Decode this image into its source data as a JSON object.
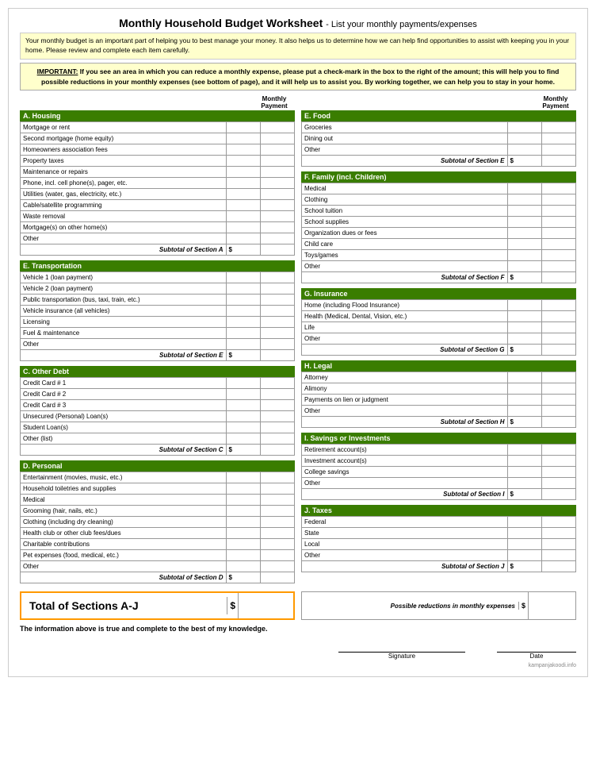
{
  "title": {
    "main": "Monthly Household Budget Worksheet",
    "subtitle": " - List your monthly payments/expenses"
  },
  "intro": "Your monthly budget is an important part of helping you to best manage your money. It also helps us to determine how we can help find opportunities to assist with keeping you in your home. Please review and complete each item carefully.",
  "important": {
    "prefix": "IMPORTANT:",
    "text": " If you see an area in which you can reduce a monthly expense, please put a check-mark in the box to the right of the amount; this will help you to find possible reductions in your monthly expenses (see bottom of page), and it will help us to assist you. By working together, we can help you to stay in your home."
  },
  "monthly_payment": "Monthly\nPayment",
  "left_column": {
    "sections": [
      {
        "id": "a",
        "header": "A. Housing",
        "items": [
          "Mortgage or rent",
          "Second mortgage (home equity)",
          "Homeowners association fees",
          "Property taxes",
          "Maintenance or repairs",
          "Phone, incl. cell phone(s), pager, etc.",
          "Utilities (water, gas, electricity, etc.)",
          "Cable/satellite programming",
          "Waste removal",
          "Mortgage(s) on other home(s)",
          "Other"
        ],
        "subtotal": "Subtotal of Section A"
      },
      {
        "id": "e_transport",
        "header": "E. Transportation",
        "items": [
          "Vehicle 1 (loan payment)",
          "Vehicle 2 (loan payment)",
          "Public transportation (bus, taxi, train, etc.)",
          "Vehicle insurance (all vehicles)",
          "Licensing",
          "Fuel & maintenance",
          "Other"
        ],
        "subtotal": "Subtotal of Section E"
      },
      {
        "id": "c",
        "header": "C. Other Debt",
        "items": [
          "Credit Card # 1",
          "Credit Card # 2",
          "Credit Card # 3",
          "Unsecured (Personal) Loan(s)",
          "Student Loan(s)",
          "Other (list)"
        ],
        "subtotal": "Subtotal of Section C"
      },
      {
        "id": "d",
        "header": "D. Personal",
        "items": [
          "Entertainment (movies, music, etc.)",
          "Household toiletries and supplies",
          "Medical",
          "Grooming (hair, nails, etc.)",
          "Clothing (including dry cleaning)",
          "Health club or other club fees/dues",
          "Charitable contributions",
          "Pet expenses (food, medical, etc.)",
          "Other"
        ],
        "subtotal": "Subtotal of Section D"
      }
    ]
  },
  "right_column": {
    "sections": [
      {
        "id": "e_food",
        "header": "E. Food",
        "items": [
          "Groceries",
          "Dining out",
          "Other"
        ],
        "subtotal": "Subtotal of Section E"
      },
      {
        "id": "f",
        "header": "F. Family (incl. Children)",
        "items": [
          "Medical",
          "Clothing",
          "School tuition",
          "School supplies",
          "Organization dues or fees",
          "Child care",
          "Toys/games",
          "Other"
        ],
        "subtotal": "Subtotal of Section F"
      },
      {
        "id": "g",
        "header": "G. Insurance",
        "items": [
          "Home (including Flood Insurance)",
          "Health (Medical, Dental, Vision, etc.)",
          "Life",
          "Other"
        ],
        "subtotal": "Subtotal of Section G"
      },
      {
        "id": "h",
        "header": "H. Legal",
        "items": [
          "Attorney",
          "Alimony",
          "Payments on lien or judgment",
          "Other"
        ],
        "subtotal": "Subtotal of Section H"
      },
      {
        "id": "i",
        "header": "I. Savings or Investments",
        "items": [
          "Retirement account(s)",
          "Investment account(s)",
          "College savings",
          "Other"
        ],
        "subtotal": "Subtotal of Section I"
      },
      {
        "id": "j",
        "header": "J. Taxes",
        "items": [
          "Federal",
          "State",
          "Local",
          "Other"
        ],
        "subtotal": "Subtotal of Section J"
      }
    ]
  },
  "total": {
    "label": "Total of Sections A-J",
    "dollar": "$"
  },
  "possible_reductions": {
    "label": "Possible reductions in monthly expenses",
    "dollar": "$"
  },
  "truth_statement": "The information above is true and complete to the best of my knowledge.",
  "signature_label": "Signature",
  "date_label": "Date",
  "watermark": "kampanjakoodi.info"
}
